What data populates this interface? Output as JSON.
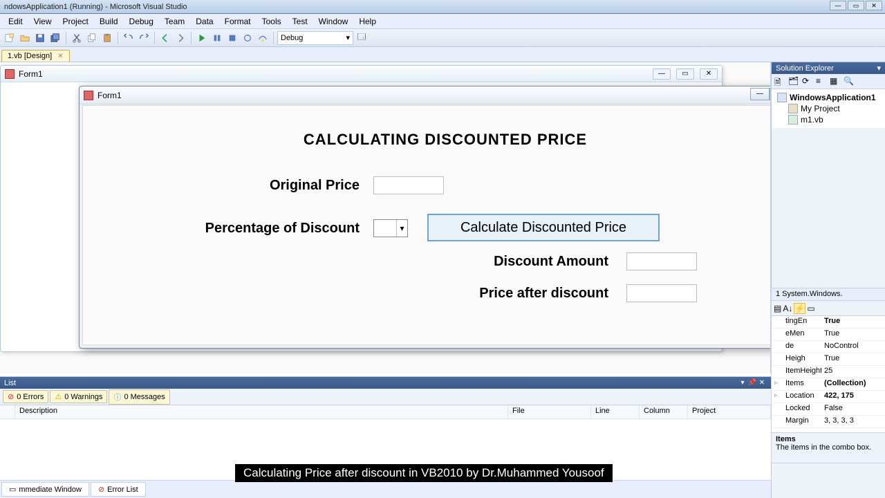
{
  "window": {
    "title": "ndowsApplication1 (Running) - Microsoft Visual Studio"
  },
  "menu": [
    "Edit",
    "View",
    "Project",
    "Build",
    "Debug",
    "Team",
    "Data",
    "Format",
    "Tools",
    "Test",
    "Window",
    "Help"
  ],
  "toolbar": {
    "config": "Debug"
  },
  "tab": {
    "label": "1.vb [Design]"
  },
  "designer_form_title": "Form1",
  "app_form": {
    "title": "Form1",
    "heading": "CALCULATING DISCOUNTED PRICE",
    "lbl_original": "Original Price",
    "lbl_percent": "Percentage of Discount",
    "btn_calc": "Calculate Discounted Price",
    "lbl_amount": "Discount Amount",
    "lbl_after": "Price after discount"
  },
  "solution_explorer": {
    "title": "Solution Explorer",
    "root": "WindowsApplication1",
    "item1": "My Project",
    "item2": "m1.vb"
  },
  "properties": {
    "header": "1 System.Windows.",
    "rows": [
      {
        "n": "tingEn",
        "v": "True",
        "b": true
      },
      {
        "n": "eMen",
        "v": "True"
      },
      {
        "n": "de",
        "v": "NoControl"
      },
      {
        "n": "Heigh",
        "v": "True"
      },
      {
        "n": "ItemHeight",
        "v": "25"
      },
      {
        "n": "Items",
        "v": "(Collection)",
        "b": true
      },
      {
        "n": "Location",
        "v": "422, 175",
        "b": true
      },
      {
        "n": "Locked",
        "v": "False"
      },
      {
        "n": "Margin",
        "v": "3, 3, 3, 3"
      }
    ],
    "desc_title": "Items",
    "desc_text": "The items in the combo box."
  },
  "error_list": {
    "title": "List",
    "tabs": {
      "errors": "0 Errors",
      "warnings": "0 Warnings",
      "messages": "0 Messages"
    },
    "cols": {
      "desc": "Description",
      "file": "File",
      "line": "Line",
      "col": "Column",
      "proj": "Project"
    }
  },
  "bottom_tabs": {
    "immediate": "mmediate Window",
    "errlist": "Error List"
  },
  "caption": "Calculating Price after discount  in VB2010  by  Dr.Muhammed Yousoof"
}
